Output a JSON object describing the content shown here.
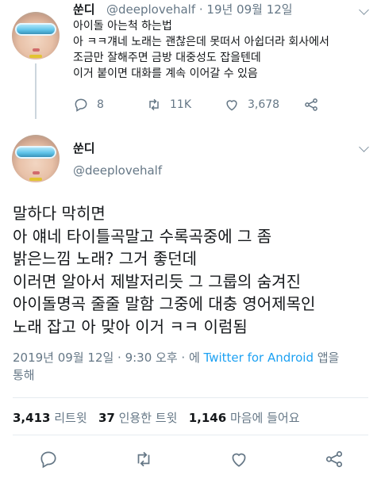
{
  "reply_tweet": {
    "name": "쑨디",
    "handle_date": "@deeplovehalf · 19년 09월 12일",
    "lines": [
      "아이돌 아는척 하는법",
      "아 ㅋㅋ걔네 노래는 괜찮은데 못떠서 아쉽더라 회사에서",
      "조금만 잘해주면 금방 대중성도 잡을텐데",
      "이거 붙이면 대화를 계속 이어갈 수 있음"
    ],
    "replies": "8",
    "retweets": "11K",
    "likes": "3,678"
  },
  "main_tweet": {
    "name": "쑨디",
    "handle": "@deeplovehalf",
    "lines": [
      "말하다 막히면",
      "아 얘네 타이틀곡말고 수록곡중에 그 좀",
      "밝은느낌 노래? 그거 좋던데",
      "이러면 알아서 제발저리듯 그 그룹의 숨겨진",
      "아이돌명곡 줄줄 말함 그중에 대충 영어제목인",
      "노래 잡고 아 맞아 이거 ㅋㅋ 이럼됨"
    ],
    "timestamp": "2019년 09월 12일 · 9:30 오후 · 에",
    "source": "Twitter for Android",
    "source_suffix": "앱을",
    "source_suffix2": "통해",
    "stats": {
      "retweets": "3,413",
      "retweets_label": "리트윗",
      "quotes": "37",
      "quotes_label": "인용한 트윗",
      "likes": "1,146",
      "likes_label": "마음에 들어요"
    }
  },
  "colors": {
    "text": "#14171a",
    "secondary": "#657786",
    "accent": "#1da1f2",
    "divider": "#e6ecf0"
  },
  "icons": [
    "reply-icon",
    "retweet-icon",
    "like-icon",
    "share-icon",
    "chevron-down-icon"
  ]
}
